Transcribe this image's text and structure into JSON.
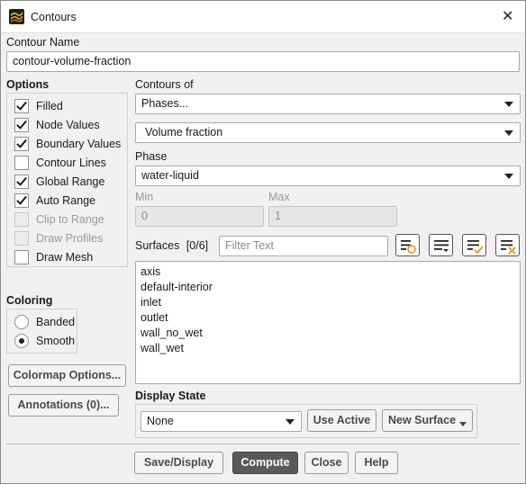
{
  "window": {
    "title": "Contours",
    "close_glyph": "✕"
  },
  "contour_name": {
    "label": "Contour Name",
    "value": "contour-volume-fraction"
  },
  "options": {
    "label": "Options",
    "items": [
      {
        "label": "Filled",
        "checked": true,
        "enabled": true
      },
      {
        "label": "Node Values",
        "checked": true,
        "enabled": true
      },
      {
        "label": "Boundary Values",
        "checked": true,
        "enabled": true
      },
      {
        "label": "Contour Lines",
        "checked": false,
        "enabled": true
      },
      {
        "label": "Global Range",
        "checked": true,
        "enabled": true
      },
      {
        "label": "Auto Range",
        "checked": true,
        "enabled": true
      },
      {
        "label": "Clip to Range",
        "checked": false,
        "enabled": false
      },
      {
        "label": "Draw Profiles",
        "checked": false,
        "enabled": false
      },
      {
        "label": "Draw Mesh",
        "checked": false,
        "enabled": true
      }
    ]
  },
  "coloring": {
    "label": "Coloring",
    "options": [
      {
        "label": "Banded",
        "selected": false
      },
      {
        "label": "Smooth",
        "selected": true
      }
    ]
  },
  "contours_of": {
    "label": "Contours of",
    "category": "Phases...",
    "quantity": "Volume fraction"
  },
  "phase": {
    "label": "Phase",
    "value": "water-liquid"
  },
  "range": {
    "min_label": "Min",
    "min_value": "0",
    "max_label": "Max",
    "max_value": "1"
  },
  "surfaces": {
    "label": "Surfaces",
    "count": "[0/6]",
    "filter_placeholder": "Filter Text",
    "items": [
      "axis",
      "default-interior",
      "inlet",
      "outlet",
      "wall_no_wet",
      "wall_wet"
    ]
  },
  "left_buttons": {
    "colormap": "Colormap Options...",
    "annotations": "Annotations (0)..."
  },
  "display_state": {
    "label": "Display State",
    "value": "None",
    "use_active": "Use Active",
    "new_surface": "New Surface"
  },
  "footer": {
    "save_display": "Save/Display",
    "compute": "Compute",
    "close": "Close",
    "help": "Help"
  },
  "icons": {
    "app": "contours-app-icon",
    "surface_tools": [
      "surface-select-icon",
      "surface-list-icon",
      "select-all-icon",
      "deselect-all-icon"
    ]
  },
  "colors": {
    "primary_button": "#5a5a5a",
    "accent_orange": "#e8a020"
  }
}
